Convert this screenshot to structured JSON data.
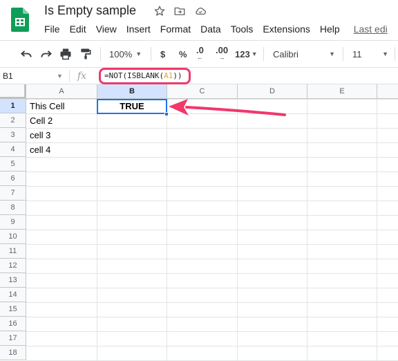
{
  "app": {
    "doc_title": "Is Empty sample",
    "menu": [
      "File",
      "Edit",
      "View",
      "Insert",
      "Format",
      "Data",
      "Tools",
      "Extensions",
      "Help"
    ],
    "last_edit": "Last edi"
  },
  "toolbar": {
    "zoom": "100%",
    "currency": "$",
    "percent": "%",
    "decrease_decimal": ".0",
    "increase_decimal": ".00",
    "more_formats": "123",
    "font": "Calibri",
    "font_size": "11"
  },
  "formula_bar": {
    "name_box": "B1",
    "fx": "fx",
    "formula_prefix": "=NOT(ISBLANK(",
    "formula_ref": "A1",
    "formula_suffix": "))"
  },
  "grid": {
    "columns": [
      "A",
      "B",
      "C",
      "D",
      "E"
    ],
    "rows": [
      "1",
      "2",
      "3",
      "4",
      "5",
      "6",
      "7",
      "8",
      "9",
      "10",
      "11",
      "12",
      "13",
      "14",
      "15",
      "16",
      "17",
      "18"
    ],
    "cells": {
      "A1": "This Cell",
      "A2": "Cell 2",
      "A3": "cell 3",
      "A4": "cell 4",
      "B1": "TRUE"
    },
    "selected_cell": "B1"
  },
  "colors": {
    "annotation": "#f0386b",
    "selection": "#1a73e8",
    "formula_ref": "#e8a42b"
  }
}
